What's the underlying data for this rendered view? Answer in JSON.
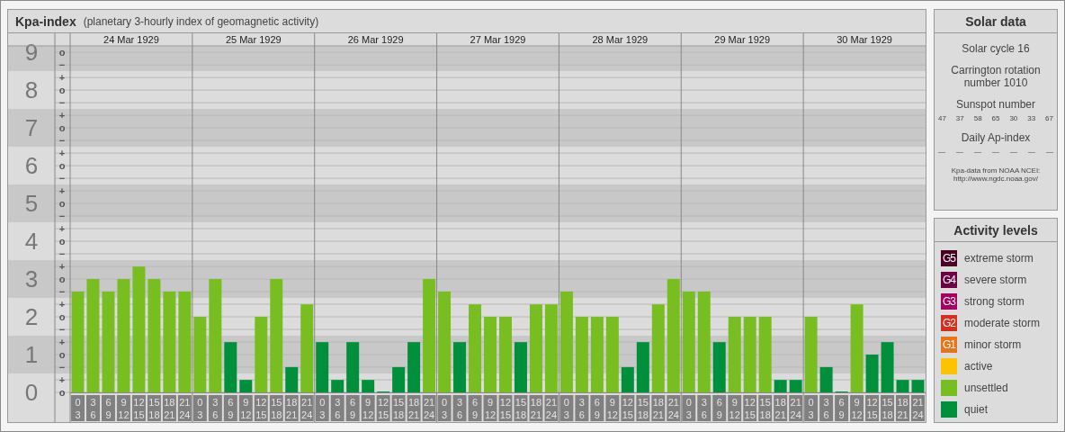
{
  "chart": {
    "title": "Kpa-index",
    "subtitle": "(planetary 3-hourly index of geomagnetic activity)",
    "subdivision_labels": [
      "o",
      "−",
      "+",
      "o",
      "−",
      "+",
      "o",
      "−",
      "+",
      "o",
      "−",
      "+",
      "o",
      "−",
      "+",
      "o",
      "−",
      "+",
      "o",
      "−",
      "+",
      "o",
      "−",
      "+",
      "o",
      "−",
      "+",
      "o"
    ],
    "days": [
      "24 Mar 1929",
      "25 Mar 1929",
      "26 Mar 1929",
      "27 Mar 1929",
      "28 Mar 1929",
      "29 Mar 1929",
      "30 Mar 1929"
    ],
    "chart_data": {
      "type": "bar",
      "grid": true,
      "ylim": [
        0,
        9.17
      ],
      "yticks": [
        9,
        8,
        7,
        6,
        5,
        4,
        3,
        2,
        1,
        0
      ],
      "categories": [
        "0\n3",
        "3\n6",
        "6\n9",
        "9\n12",
        "12\n15",
        "15\n18",
        "18\n21",
        "21\n24",
        "0\n3",
        "3\n6",
        "6\n9",
        "9\n12",
        "12\n15",
        "15\n18",
        "18\n21",
        "21\n24",
        "0\n3",
        "3\n6",
        "6\n9",
        "9\n12",
        "12\n15",
        "15\n18",
        "18\n21",
        "21\n24",
        "0\n3",
        "3\n6",
        "6\n9",
        "9\n12",
        "12\n15",
        "15\n18",
        "18\n21",
        "21\n24",
        "0\n3",
        "3\n6",
        "6\n9",
        "9\n12",
        "12\n15",
        "15\n18",
        "18\n21",
        "21\n24",
        "0\n3",
        "3\n6",
        "6\n9",
        "9\n12",
        "12\n15",
        "15\n18",
        "18\n21",
        "21\n24",
        "0\n3",
        "3\n6",
        "6\n9",
        "9\n12",
        "12\n15",
        "15\n18",
        "18\n21",
        "21\n24"
      ],
      "series": [
        {
          "color": "#00903c",
          "values": [
            null,
            null,
            null,
            null,
            null,
            null,
            null,
            null,
            null,
            null,
            1.33,
            0.33,
            null,
            null,
            0.67,
            null,
            1.33,
            0.33,
            1.33,
            0.33,
            0,
            0.67,
            1.33,
            null,
            null,
            1.33,
            null,
            null,
            null,
            1.33,
            null,
            null,
            null,
            null,
            null,
            null,
            0.67,
            1.33,
            null,
            null,
            null,
            null,
            1.33,
            null,
            null,
            null,
            0.33,
            0.33,
            null,
            0.67,
            0,
            null,
            1,
            1.33,
            0.33,
            0.33
          ]
        },
        {
          "color": "#78be20",
          "values": [
            2.67,
            3,
            2.67,
            3,
            3.33,
            3,
            2.67,
            2.67,
            2,
            3,
            null,
            null,
            2,
            3,
            null,
            2.33,
            null,
            null,
            null,
            null,
            null,
            null,
            null,
            3,
            2.67,
            null,
            2.33,
            2,
            2,
            null,
            2.33,
            2.33,
            2.67,
            2,
            2,
            2,
            null,
            null,
            2.33,
            3,
            2.67,
            2.67,
            null,
            2,
            2,
            2,
            null,
            null,
            2,
            null,
            null,
            2.33,
            null,
            null,
            null,
            null
          ]
        }
      ]
    }
  },
  "solar_data": {
    "title": "Solar data",
    "solar_cycle": "Solar cycle 16",
    "carrington_rotation": "Carrington rotation number 1010",
    "sunspot_title": "Sunspot number",
    "sunspot_numbers": [
      "47",
      "37",
      "58",
      "65",
      "30",
      "33",
      "67"
    ],
    "ap_title": "Daily Ap-index",
    "ap_values": [
      "—",
      "—",
      "—",
      "—",
      "—",
      "—",
      "—"
    ],
    "source": "Kpa-data from NOAA NCEI:",
    "source_url": "http://www.ngdc.noaa.gov/"
  },
  "activity_levels": {
    "title": "Activity levels",
    "items": [
      {
        "badge": "G5",
        "label": "extreme storm",
        "color": "#4a0022"
      },
      {
        "badge": "G4",
        "label": "severe storm",
        "color": "#6e0042"
      },
      {
        "badge": "G3",
        "label": "strong storm",
        "color": "#a8005e"
      },
      {
        "badge": "G2",
        "label": "moderate storm",
        "color": "#d82e1e"
      },
      {
        "badge": "G1",
        "label": "minor storm",
        "color": "#e87418"
      },
      {
        "label": "active",
        "color": "#fcc400"
      },
      {
        "label": "unsettled",
        "color": "#78be20"
      },
      {
        "label": "quiet",
        "color": "#00903c"
      }
    ]
  }
}
